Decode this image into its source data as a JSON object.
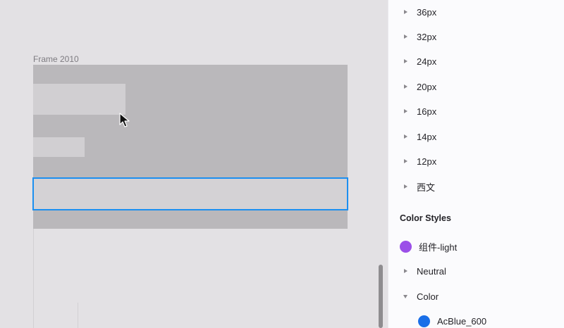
{
  "canvas": {
    "frame_label": "Frame 2010"
  },
  "panel": {
    "text_styles": [
      {
        "label": "36px"
      },
      {
        "label": "32px"
      },
      {
        "label": "24px"
      },
      {
        "label": "20px"
      },
      {
        "label": "16px"
      },
      {
        "label": "14px"
      },
      {
        "label": "12px"
      },
      {
        "label": "西文"
      }
    ],
    "color_styles_title": "Color Styles",
    "color_styles": {
      "item_light": {
        "label": "组件-light",
        "color": "#9b4fe8"
      },
      "group_neutral": {
        "label": "Neutral"
      },
      "group_color": {
        "label": "Color"
      },
      "item_acblue": {
        "label": "AcBlue_600",
        "color": "#1a6fe8"
      }
    }
  },
  "colors": {
    "selection": "#1c8ff0",
    "frame_fill": "#bab8bb",
    "canvas_bg": "#e3e1e4"
  }
}
